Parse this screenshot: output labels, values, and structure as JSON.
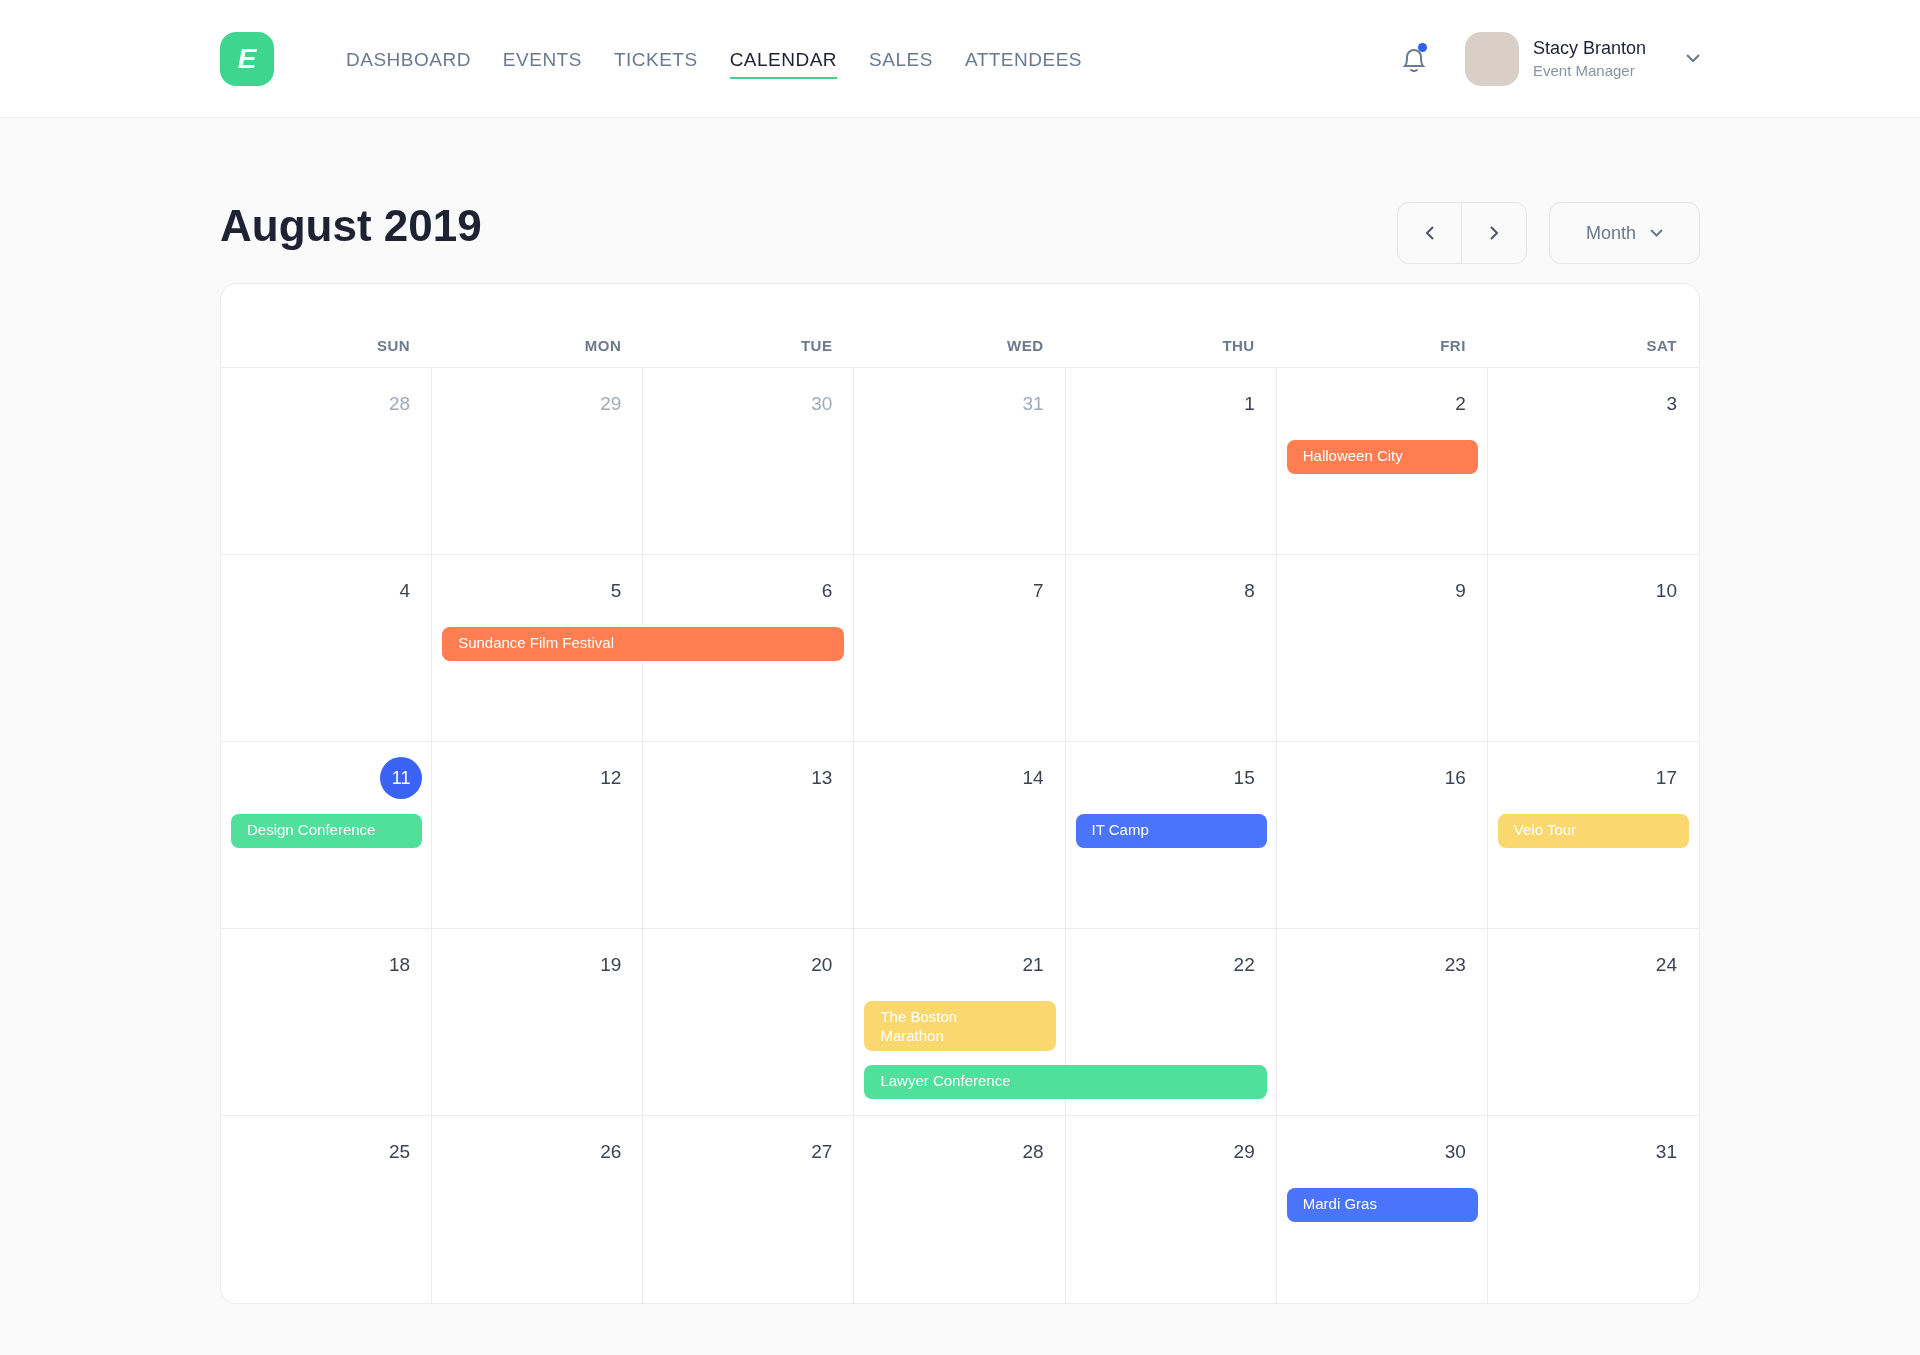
{
  "logo": {
    "letter": "E"
  },
  "nav": [
    {
      "label": "DASHBOARD",
      "selected": false
    },
    {
      "label": "EVENTS",
      "selected": false
    },
    {
      "label": "TICKETS",
      "selected": false
    },
    {
      "label": "CALENDAR",
      "selected": true
    },
    {
      "label": "SALES",
      "selected": false
    },
    {
      "label": "ATTENDEES",
      "selected": false
    }
  ],
  "notifications": {
    "unread": true
  },
  "user": {
    "name": "Stacy Branton",
    "role": "Event Manager"
  },
  "title": "August 2019",
  "view_select": {
    "value": "Month"
  },
  "weekdays": [
    "SUN",
    "MON",
    "TUE",
    "WED",
    "THU",
    "FRI",
    "SAT"
  ],
  "weeks": [
    {
      "days": [
        {
          "label": "28",
          "outside_month": true,
          "today": false
        },
        {
          "label": "29",
          "outside_month": true,
          "today": false
        },
        {
          "label": "30",
          "outside_month": true,
          "today": false
        },
        {
          "label": "31",
          "outside_month": true,
          "today": false
        },
        {
          "label": "1",
          "outside_month": false,
          "today": false
        },
        {
          "label": "2",
          "outside_month": false,
          "today": false,
          "events": [
            {
              "title": "Halloween City",
              "color": "#fe7e51",
              "continues": false
            }
          ]
        },
        {
          "label": "3",
          "outside_month": false,
          "today": false
        }
      ]
    },
    {
      "days": [
        {
          "label": "4",
          "outside_month": false,
          "today": false
        },
        {
          "label": "5",
          "outside_month": false,
          "today": false,
          "events": [
            {
              "title": "Sundance Film Festival",
              "color": "#fe7e51",
              "continues": true
            }
          ]
        },
        {
          "label": "6",
          "outside_month": false,
          "today": false
        },
        {
          "label": "7",
          "outside_month": false,
          "today": false
        },
        {
          "label": "8",
          "outside_month": false,
          "today": false
        },
        {
          "label": "9",
          "outside_month": false,
          "today": false
        },
        {
          "label": "10",
          "outside_month": false,
          "today": false
        }
      ]
    },
    {
      "days": [
        {
          "label": "11",
          "outside_month": false,
          "today": true,
          "events": [
            {
              "title": "Design Conference",
              "color": "#50e09c",
              "continues": false
            }
          ]
        },
        {
          "label": "12",
          "outside_month": false,
          "today": false
        },
        {
          "label": "13",
          "outside_month": false,
          "today": false
        },
        {
          "label": "14",
          "outside_month": false,
          "today": false
        },
        {
          "label": "15",
          "outside_month": false,
          "today": false,
          "events": [
            {
              "title": "IT Camp",
              "color": "#4a74fc",
              "continues": false
            }
          ]
        },
        {
          "label": "16",
          "outside_month": false,
          "today": false
        },
        {
          "label": "17",
          "outside_month": false,
          "today": false,
          "events": [
            {
              "title": "Velo Tour",
              "color": "#fbd86f",
              "continues": false
            }
          ]
        }
      ]
    },
    {
      "days": [
        {
          "label": "18",
          "outside_month": false,
          "today": false
        },
        {
          "label": "19",
          "outside_month": false,
          "today": false
        },
        {
          "label": "20",
          "outside_month": false,
          "today": false
        },
        {
          "label": "21",
          "outside_month": false,
          "today": false,
          "events": [
            {
              "title": "The Boston Marathon",
              "color": "#fbd86f",
              "continues": false
            },
            {
              "title": "Lawyer Conference",
              "color": "#50e09c",
              "continues": true
            }
          ]
        },
        {
          "label": "22",
          "outside_month": false,
          "today": false
        },
        {
          "label": "23",
          "outside_month": false,
          "today": false
        },
        {
          "label": "24",
          "outside_month": false,
          "today": false
        }
      ]
    },
    {
      "days": [
        {
          "label": "25",
          "outside_month": false,
          "today": false
        },
        {
          "label": "26",
          "outside_month": false,
          "today": false
        },
        {
          "label": "27",
          "outside_month": false,
          "today": false
        },
        {
          "label": "28",
          "outside_month": false,
          "today": false
        },
        {
          "label": "29",
          "outside_month": false,
          "today": false
        },
        {
          "label": "30",
          "outside_month": false,
          "today": false,
          "events": [
            {
              "title": "Mardi Gras",
              "color": "#4a74fc",
              "continues": false
            }
          ]
        },
        {
          "label": "31",
          "outside_month": false,
          "today": false
        }
      ]
    }
  ]
}
